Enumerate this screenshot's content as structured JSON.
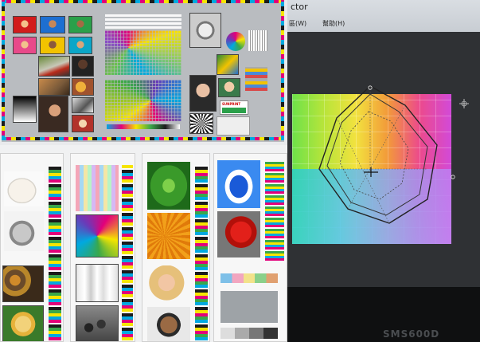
{
  "menubar": {
    "title_fragment": "ctor",
    "menu_items": [
      "區(W)",
      "幫助(H)"
    ]
  },
  "monitor": {
    "brand_fragment": "SMS600D"
  },
  "top_sheet": {
    "logo_text": "SUNPRINT"
  },
  "colors": {
    "cyan": "#00a9e0",
    "magenta": "#e2007a",
    "yellow": "#f6e500",
    "black": "#1b1b1b",
    "sheet_gray": "#b9bcc0",
    "screen_dark": "#2f3134"
  },
  "icons": [
    "crosshair-icon"
  ]
}
